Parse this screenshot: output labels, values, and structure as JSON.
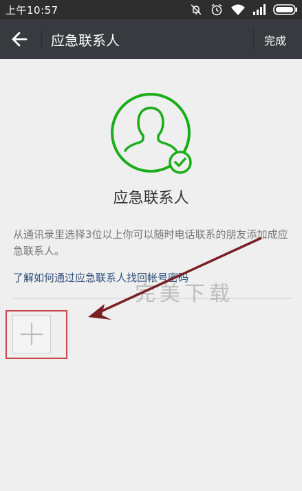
{
  "status_bar": {
    "time": "上午10:57",
    "icons": [
      "mute-icon",
      "alarm-icon",
      "wifi-icon",
      "signal-icon",
      "battery-icon"
    ]
  },
  "app_bar": {
    "title": "应急联系人",
    "done_label": "完成",
    "back_icon": "back-arrow-icon"
  },
  "main": {
    "heading": "应急联系人",
    "description": "从通讯录里选择3位以上你可以随时电话联系的朋友添加成应急联系人。",
    "help_link": "了解如何通过应急联系人找回帐号密码",
    "add_icon": "plus-icon"
  },
  "watermark": "完美下载",
  "colors": {
    "status_bar": "#2e2e2e",
    "app_bar": "#393a3f",
    "accent_green": "#1aad19",
    "highlight_red": "#c9484b",
    "arrow": "#7a1f24",
    "link": "#2f4f7a"
  }
}
